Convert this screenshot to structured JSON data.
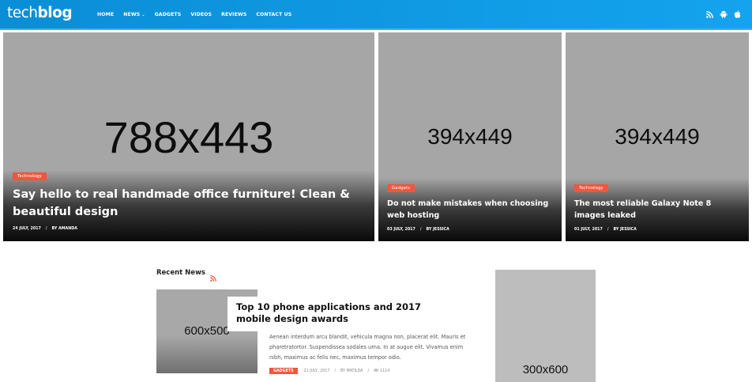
{
  "header": {
    "logo_part1": "tech",
    "logo_part2": "blog",
    "nav": [
      "HOME",
      "NEWS",
      "GADGETS",
      "VIDEOS",
      "REVIEWS",
      "CONTACT US"
    ],
    "social_icons": [
      "rss-icon",
      "android-icon",
      "apple-icon"
    ],
    "colors": {
      "header_bg": "#0a8ed6",
      "accent": "#f0563f"
    }
  },
  "hero": [
    {
      "placeholder": "788x443",
      "category": "Technology",
      "title": "Say hello to real handmade office furniture! Clean & beautiful design",
      "date": "24 JULY, 2017",
      "author": "BY AMANDA"
    },
    {
      "placeholder": "394x449",
      "category": "Gadgets",
      "title": "Do not make mistakes when choosing web hosting",
      "date": "03 JULY, 2017",
      "author": "BY JESSICA"
    },
    {
      "placeholder": "394x449",
      "category": "Technology",
      "title": "The most reliable Galaxy Note 8 images leaked",
      "date": "01 JULY, 2017",
      "author": "BY JESSICA"
    }
  ],
  "recent": {
    "title": "Recent News",
    "thumb_placeholder": "600x500",
    "article_title": "Top 10 phone applications and 2017 mobile design awards",
    "excerpt": "Aenean interdum arcu blandit, vehicula magna non, placerat elit. Mauris et pharetratortor. Suspendissea sodales urna. In at augue elit. Vivamus enim nibh, maximus ac felis nec, maximus tempor odio.",
    "category": "GADGETS",
    "date": "21 JULY, 2017",
    "author": "BY MATILDA",
    "views": "1114"
  },
  "ad": {
    "placeholder": "300x600"
  }
}
